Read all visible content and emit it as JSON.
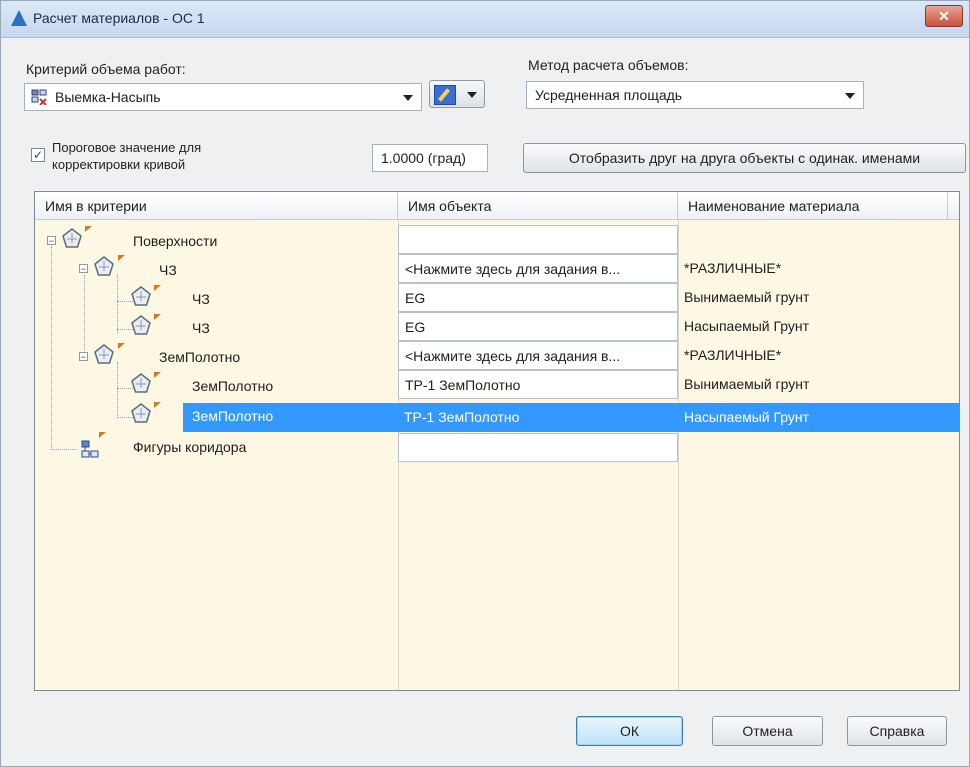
{
  "window": {
    "title": "Расчет материалов - ОС 1",
    "close_label": "✕"
  },
  "criteria": {
    "label": "Критерий объема работ:",
    "value": "Выемка-Насыпь"
  },
  "method": {
    "label": "Метод расчета объемов:",
    "value": "Усредненная площадь"
  },
  "threshold": {
    "checkbox_checked": "✓",
    "label_line1": "Пороговое значение для",
    "label_line2": "корректировки кривой",
    "value": "1.0000 (град)"
  },
  "display_button_label": "Отобразить друг на друга объекты с одинак. именами",
  "grid": {
    "columns": [
      "Имя в критерии",
      "Имя объекта",
      "Наименование материала"
    ],
    "rows": [
      {
        "name": "Поверхности",
        "object": "",
        "material": ""
      },
      {
        "name": "ЧЗ",
        "object": "<Нажмите здесь для задания в...",
        "material": "*РАЗЛИЧНЫЕ*"
      },
      {
        "name": "ЧЗ",
        "object": "EG",
        "material": "Вынимаемый грунт"
      },
      {
        "name": "ЧЗ",
        "object": "EG",
        "material": "Насыпаемый Грунт"
      },
      {
        "name": "ЗемПолотно",
        "object": "<Нажмите здесь для задания в...",
        "material": "*РАЗЛИЧНЫЕ*"
      },
      {
        "name": "ЗемПолотно",
        "object": "TP-1 ЗемПолотно",
        "material": "Вынимаемый грунт"
      },
      {
        "name": "ЗемПолотно",
        "object": "TP-1 ЗемПолотно",
        "material": "Насыпаемый Грунт"
      },
      {
        "name": "Фигуры коридора",
        "object": "",
        "material": ""
      }
    ],
    "selected_row": 6
  },
  "buttons": {
    "ok": "ОК",
    "cancel": "Отмена",
    "help": "Справка"
  },
  "colors": {
    "selection": "#3399ff",
    "grid_background": "#fdf8e3"
  }
}
